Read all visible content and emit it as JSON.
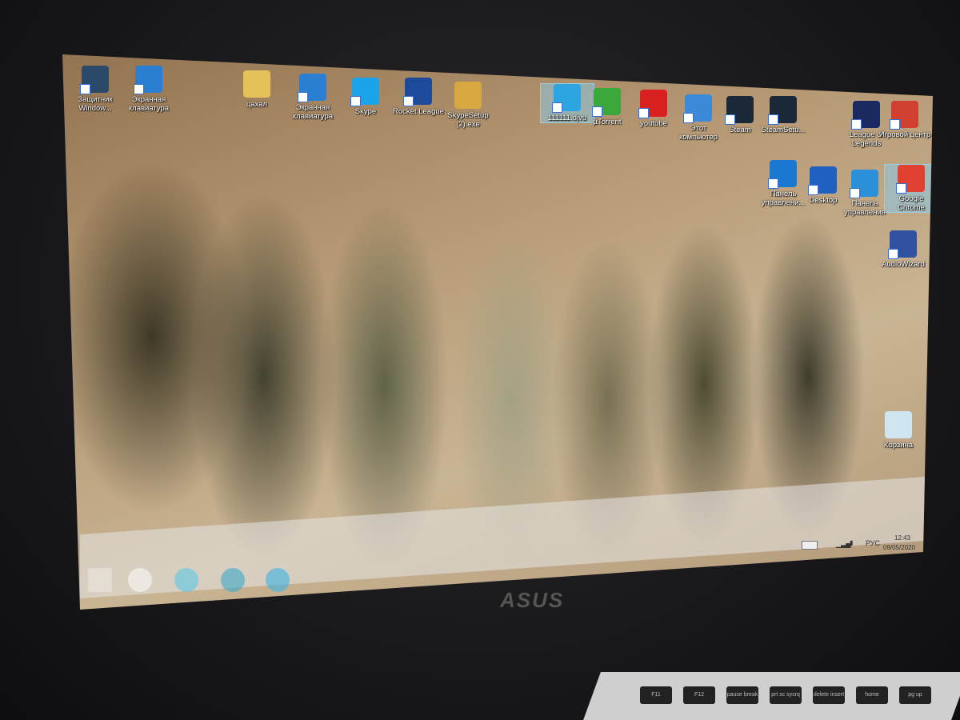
{
  "desktop_icons": [
    {
      "label": "Защитник Window...",
      "icon": "windows-defender-icon",
      "color": "#2b4a6a"
    },
    {
      "label": "Экранная клавиатура",
      "icon": "on-screen-keyboard-icon",
      "color": "#2a7fd0"
    },
    {
      "label": "цахал",
      "icon": "folder-icon",
      "color": "#e5c15a"
    },
    {
      "label": "Экранная клавиатура",
      "icon": "on-screen-keyboard-icon",
      "color": "#2a7fd0"
    },
    {
      "label": "Skype",
      "icon": "skype-icon",
      "color": "#1aa3e8"
    },
    {
      "label": "Rocket League",
      "icon": "rocket-league-icon",
      "color": "#1d4a9a"
    },
    {
      "label": "SkypeSetup (2).exe",
      "icon": "installer-icon",
      "color": "#d8a840"
    },
    {
      "label": "111111.djvu",
      "icon": "internet-explorer-icon",
      "color": "#2ea4e0"
    },
    {
      "label": "µTorrent",
      "icon": "utorrent-icon",
      "color": "#3aa83a"
    },
    {
      "label": "youtube",
      "icon": "youtube-icon",
      "color": "#d92020"
    },
    {
      "label": "Этот компьютер",
      "icon": "computer-icon",
      "color": "#3a8ad8"
    },
    {
      "label": "Steam",
      "icon": "steam-icon",
      "color": "#1b2838"
    },
    {
      "label": "SteamSetu...",
      "icon": "steam-setup-icon",
      "color": "#1b2838"
    },
    {
      "label": "League of Legends",
      "icon": "league-of-legends-icon",
      "color": "#1a2a60"
    },
    {
      "label": "Игровой центр",
      "icon": "game-center-icon",
      "color": "#d04030"
    },
    {
      "label": "Панель управлени...",
      "icon": "intel-control-panel-icon",
      "color": "#1a78d0"
    },
    {
      "label": "Desktop",
      "icon": "desktop-icon",
      "color": "#2060c0"
    },
    {
      "label": "Панель управления",
      "icon": "control-panel-icon",
      "color": "#2a90d8"
    },
    {
      "label": "Google Chrome",
      "icon": "chrome-icon",
      "color": "#e04030"
    },
    {
      "label": "AudioWizard",
      "icon": "audiowizard-icon",
      "color": "#3050a0"
    },
    {
      "label": "Корзина",
      "icon": "recycle-bin-icon",
      "color": "#cfe6f0"
    }
  ],
  "tray": {
    "language": "РУС",
    "time": "12:43",
    "date": "09/05/2020"
  },
  "laptop": {
    "brand": "ASUS"
  },
  "keys": [
    "F11",
    "F12",
    "pause break",
    "prt sc sysrq",
    "delete insert",
    "home",
    "pg up"
  ]
}
